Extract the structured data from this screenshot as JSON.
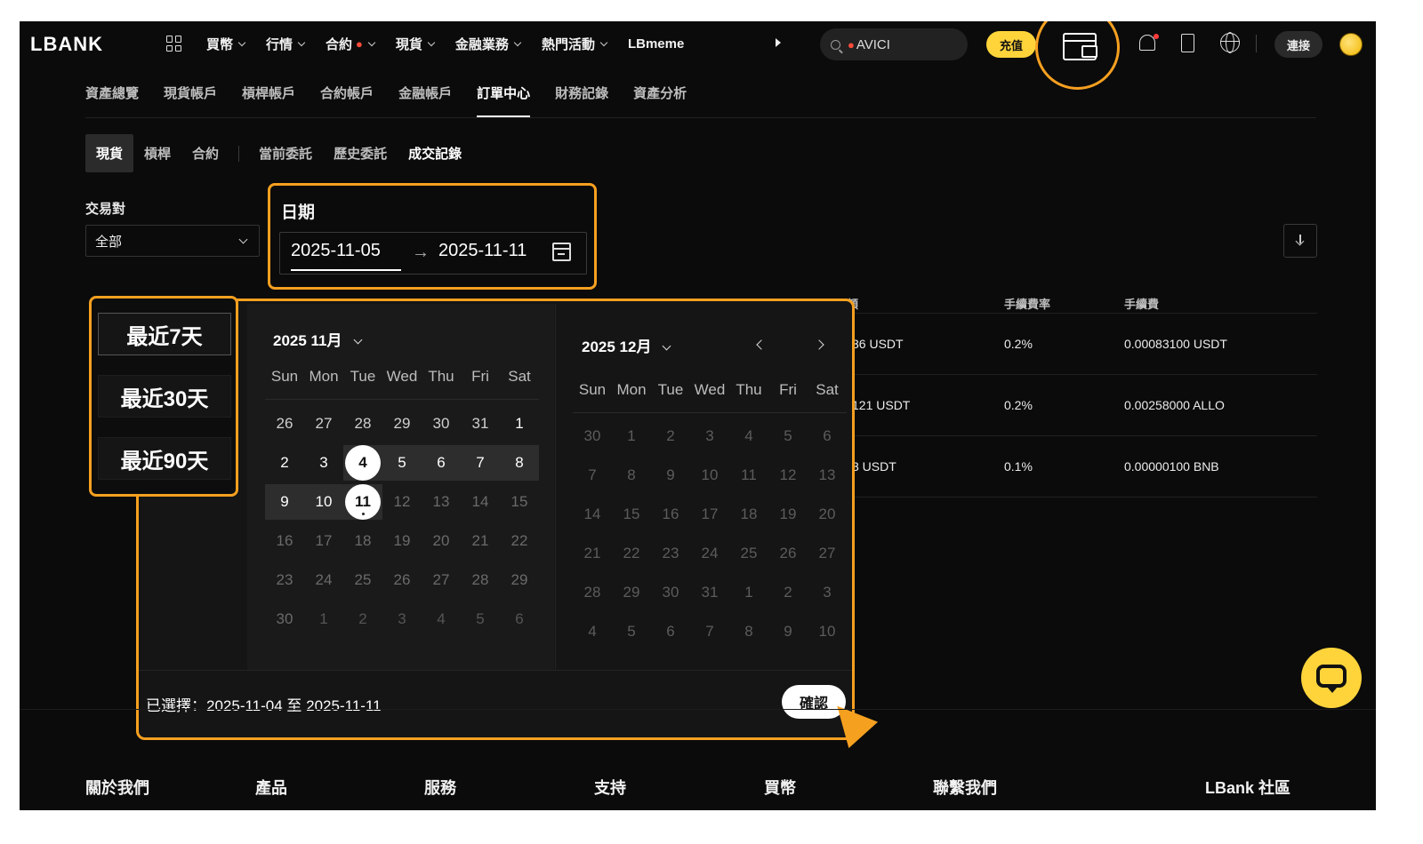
{
  "topnav": {
    "logo": "LBANK",
    "menu": [
      {
        "label": "買幣",
        "hot": false
      },
      {
        "label": "行情",
        "hot": false
      },
      {
        "label": "合約",
        "hot": true
      },
      {
        "label": "現貨",
        "hot": false
      },
      {
        "label": "金融業務",
        "hot": false
      },
      {
        "label": "熱門活動",
        "hot": false
      },
      {
        "label": "LBmeme",
        "hot": false
      }
    ],
    "search_value": "AVICI",
    "deposit_label": "充值",
    "connect_label": "連接"
  },
  "subnav": {
    "items": [
      "資產總覽",
      "現貨帳戶",
      "槓桿帳戶",
      "合約帳戶",
      "金融帳戶",
      "訂單中心",
      "財務記錄",
      "資產分析"
    ],
    "active": "訂單中心"
  },
  "order_tabs": {
    "market": [
      "現貨",
      "槓桿",
      "合約"
    ],
    "records": [
      "當前委託",
      "歷史委託",
      "成交記錄"
    ]
  },
  "filters": {
    "pair_label": "交易對",
    "pair_value": "全部",
    "date_label": "日期",
    "date_start": "2025-11-05",
    "date_end": "2025-11-11"
  },
  "table": {
    "headers": [
      "手續費率",
      "手續費"
    ],
    "rows": [
      {
        "partial": "36 USDT",
        "rate": "0.2%",
        "fee": "0.00083100 USDT"
      },
      {
        "partial": "121 USDT",
        "rate": "0.2%",
        "fee": "0.00258000 ALLO"
      },
      {
        "partial": "3 USDT",
        "rate": "0.1%",
        "fee": "0.00000100 BNB"
      }
    ],
    "header_partial": "額"
  },
  "presets": [
    "最近7天",
    "最近30天",
    "最近90天"
  ],
  "calendar": {
    "weekdays": [
      "Sun",
      "Mon",
      "Tue",
      "Wed",
      "Thu",
      "Fri",
      "Sat"
    ],
    "left_title": "2025 11月",
    "right_title": "2025 12月",
    "left_weeks": [
      [
        "26",
        "27",
        "28",
        "29",
        "30",
        "31",
        "1"
      ],
      [
        "2",
        "3",
        "4",
        "5",
        "6",
        "7",
        "8"
      ],
      [
        "9",
        "10",
        "11",
        "12",
        "13",
        "14",
        "15"
      ],
      [
        "16",
        "17",
        "18",
        "19",
        "20",
        "21",
        "22"
      ],
      [
        "23",
        "24",
        "25",
        "26",
        "27",
        "28",
        "29"
      ],
      [
        "30",
        "1",
        "2",
        "3",
        "4",
        "5",
        "6"
      ]
    ],
    "right_weeks": [
      [
        "30",
        "1",
        "2",
        "3",
        "4",
        "5",
        "6"
      ],
      [
        "7",
        "8",
        "9",
        "10",
        "11",
        "12",
        "13"
      ],
      [
        "14",
        "15",
        "16",
        "17",
        "18",
        "19",
        "20"
      ],
      [
        "21",
        "22",
        "23",
        "24",
        "25",
        "26",
        "27"
      ],
      [
        "28",
        "29",
        "30",
        "31",
        "1",
        "2",
        "3"
      ],
      [
        "4",
        "5",
        "6",
        "7",
        "8",
        "9",
        "10"
      ]
    ],
    "range_start": "4",
    "range_end": "11",
    "selected_text": "已選擇：2025-11-04 至 2025-11-11",
    "confirm_label": "確認"
  },
  "footer": [
    "關於我們",
    "產品",
    "服務",
    "支持",
    "買幣",
    "聯繫我們",
    "LBank 社區"
  ],
  "colors": {
    "accent": "#f6a020",
    "brand_yellow": "#ffd43b",
    "background": "#0b0b0b"
  }
}
